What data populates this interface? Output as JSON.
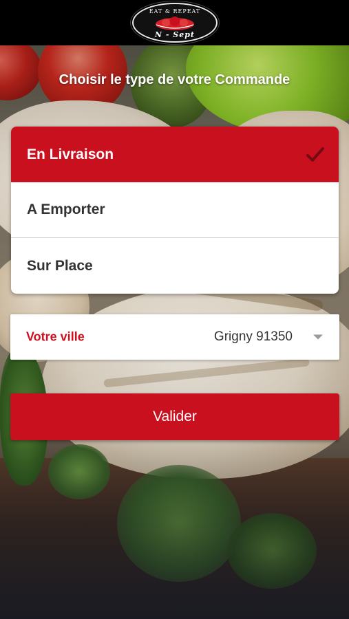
{
  "header": {
    "logo": {
      "top_text": "EAT & REPEAT",
      "name": "N - Sept"
    }
  },
  "page": {
    "heading": "Choisir le type de votre Commande"
  },
  "order_types": [
    {
      "label": "En Livraison",
      "selected": true
    },
    {
      "label": "A Emporter",
      "selected": false
    },
    {
      "label": "Sur Place",
      "selected": false
    }
  ],
  "city": {
    "label": "Votre ville",
    "value": "Grigny 91350"
  },
  "actions": {
    "validate_label": "Valider"
  },
  "colors": {
    "accent": "#c8101f",
    "city_label": "#d0101f",
    "header_bg": "#000000",
    "text_dark": "#333333"
  },
  "icons": {
    "selected_marker": "checkmark-icon",
    "dropdown": "dropdown-caret-icon"
  }
}
